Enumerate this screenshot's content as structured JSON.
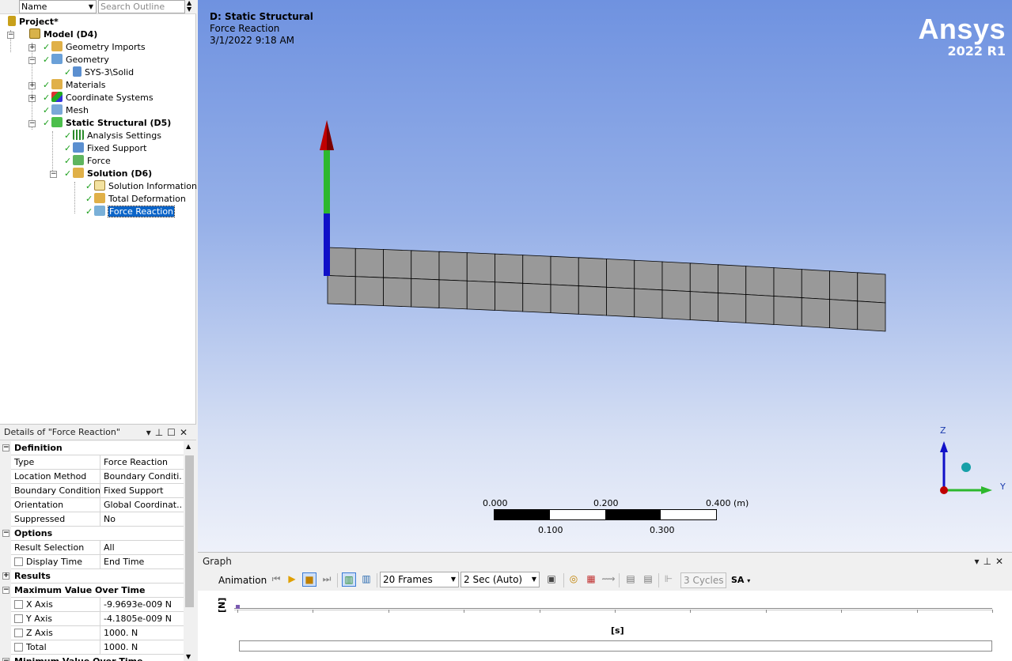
{
  "outline": {
    "name_filter": "Name",
    "search_placeholder": "Search Outline",
    "tree": [
      {
        "label": "Project*"
      },
      {
        "label": "Model (D4)"
      },
      {
        "label": "Geometry Imports"
      },
      {
        "label": "Geometry"
      },
      {
        "label": "SYS-3\\Solid"
      },
      {
        "label": "Materials"
      },
      {
        "label": "Coordinate Systems"
      },
      {
        "label": "Mesh"
      },
      {
        "label": "Static Structural (D5)"
      },
      {
        "label": "Analysis Settings"
      },
      {
        "label": "Fixed Support"
      },
      {
        "label": "Force"
      },
      {
        "label": "Solution (D6)"
      },
      {
        "label": "Solution Information"
      },
      {
        "label": "Total Deformation"
      },
      {
        "label": "Force Reaction"
      }
    ]
  },
  "details": {
    "title": "Details of \"Force Reaction\"",
    "rows": [
      {
        "key": "Definition"
      },
      {
        "key": "Type",
        "value": "Force Reaction"
      },
      {
        "key": "Location Method",
        "value": "Boundary Conditi..."
      },
      {
        "key": "Boundary Condition",
        "value": "Fixed Support"
      },
      {
        "key": "Orientation",
        "value": "Global Coordinat..."
      },
      {
        "key": "Suppressed",
        "value": "No"
      },
      {
        "key": "Options"
      },
      {
        "key": "Result Selection",
        "value": "All"
      },
      {
        "key": "Display Time",
        "value": "End Time"
      },
      {
        "key": "Results"
      },
      {
        "key": "Maximum Value Over Time"
      },
      {
        "key": "X Axis",
        "value": "-9.9693e-009 N"
      },
      {
        "key": "Y Axis",
        "value": "-4.1805e-009 N"
      },
      {
        "key": "Z Axis",
        "value": "1000. N"
      },
      {
        "key": "Total",
        "value": "1000. N"
      },
      {
        "key": "Minimum Value Over Time"
      }
    ]
  },
  "viewport": {
    "title": "D: Static Structural",
    "subtitle": "Force Reaction",
    "datetime": "3/1/2022 9:18 AM",
    "logo_brand": "Ansys",
    "logo_version": "2022 R1",
    "scale": {
      "l0": "0.000",
      "l1": "0.200",
      "l2": "0.400",
      "unit": "(m)",
      "b1": "0.100",
      "b2": "0.300"
    },
    "triad": {
      "z": "Z",
      "y": "Y"
    },
    "colors": {
      "arrow_red": "#c00000",
      "arrow_green": "#2db82d",
      "arrow_blue": "#1010c8",
      "mesh_fill": "#999999"
    }
  },
  "graph": {
    "title": "Graph",
    "animation_label": "Animation",
    "frames": "20 Frames",
    "duration": "2 Sec (Auto)",
    "cycles": "3 Cycles",
    "sa_label": "SA",
    "y_axis": "[N]",
    "x_axis": "[s]"
  }
}
